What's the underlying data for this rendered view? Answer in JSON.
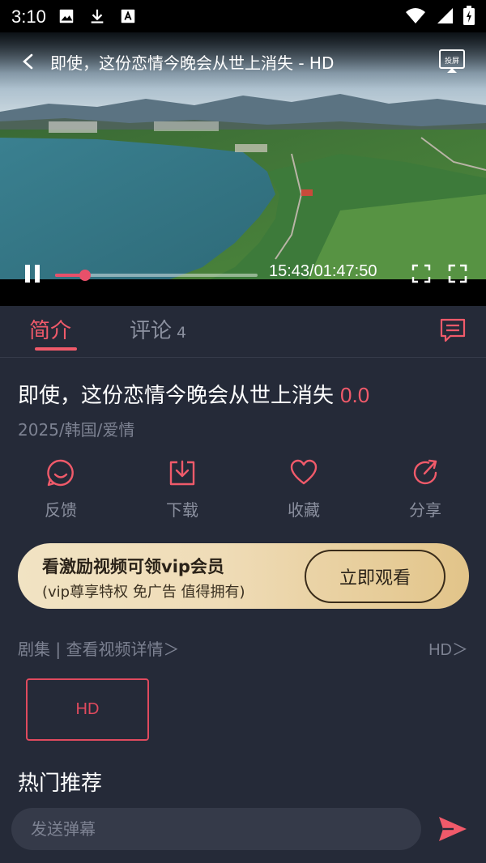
{
  "status_bar": {
    "time": "3:10",
    "icons": [
      "image-icon",
      "download-icon",
      "a-box-icon",
      "wifi-icon",
      "signal-icon",
      "battery-charging-icon"
    ]
  },
  "player": {
    "title": "即使，这份恋情今晚会从世上消失 - HD",
    "cast_label": "投屏",
    "time_display": "15:43/01:47:50",
    "progress_fraction": 0.146,
    "state": "playing"
  },
  "tabs": {
    "intro_label": "简介",
    "comments_label": "评论",
    "comments_count": "4"
  },
  "info": {
    "title": "即使，这份恋情今晚会从世上消失",
    "score": "0.0",
    "meta": "2025/韩国/爱情"
  },
  "actions": [
    {
      "label": "反馈",
      "icon": "feedback-smile-icon"
    },
    {
      "label": "下载",
      "icon": "download-icon"
    },
    {
      "label": "收藏",
      "icon": "heart-icon"
    },
    {
      "label": "分享",
      "icon": "share-icon"
    }
  ],
  "vip": {
    "title": "看激励视频可领vip会员",
    "subtitle": "(vip尊享特权 免广告 值得拥有)",
    "button_label": "立即观看"
  },
  "episodes": {
    "header": "剧集 | 查看视频详情＞",
    "quality": "HD＞",
    "items": [
      "HD"
    ]
  },
  "recommend": {
    "title": "热门推荐"
  },
  "danmaku": {
    "placeholder": "发送弹幕"
  },
  "colors": {
    "accent": "#f05a6a",
    "background": "#252a38",
    "muted_text": "#7d8292",
    "vip_gold": "#e2c489"
  }
}
